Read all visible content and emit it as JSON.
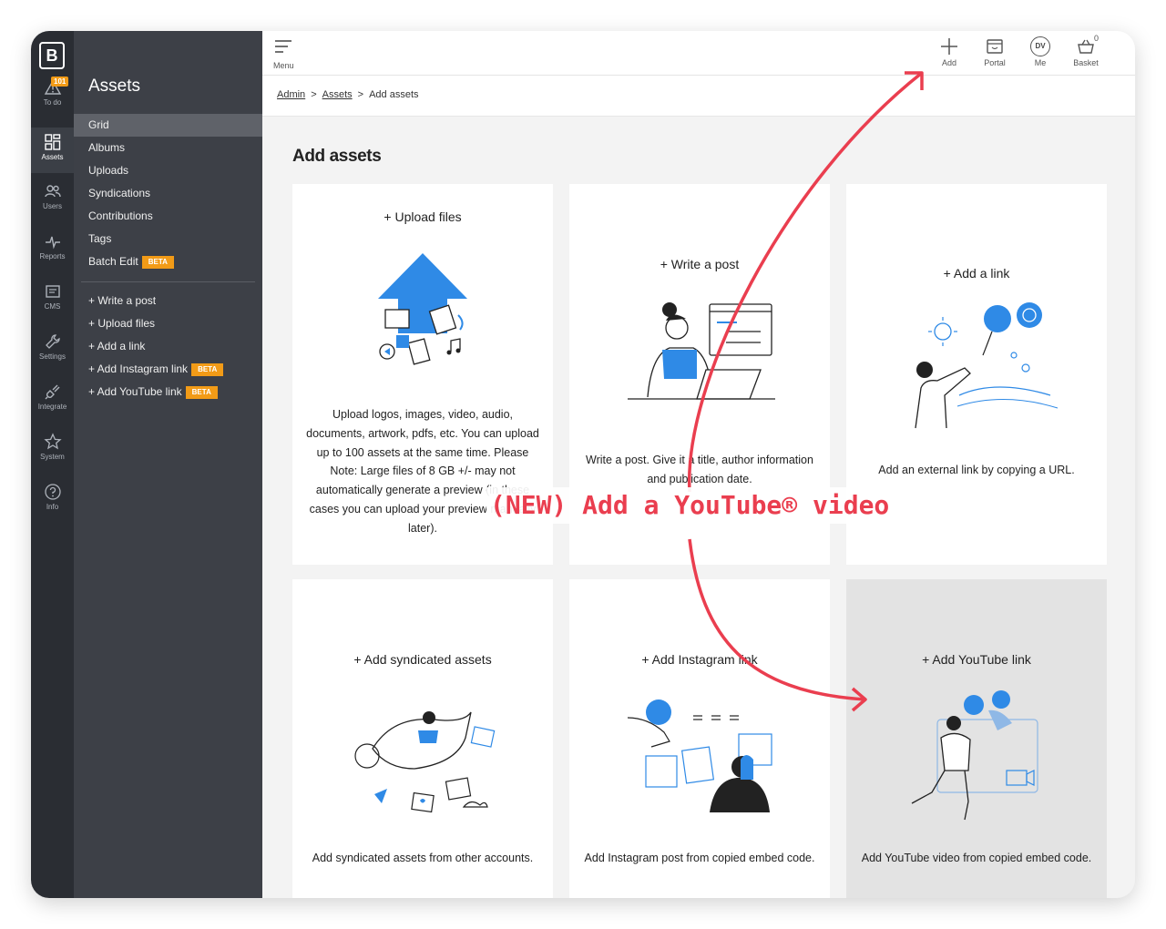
{
  "app": {
    "logo": "B"
  },
  "rail": {
    "items": [
      {
        "label": "To do",
        "icon": "warning-icon",
        "badge": "101"
      },
      {
        "label": "Assets",
        "icon": "grid-icon"
      },
      {
        "label": "Users",
        "icon": "users-icon"
      },
      {
        "label": "Reports",
        "icon": "pulse-icon"
      },
      {
        "label": "CMS",
        "icon": "edit-icon"
      },
      {
        "label": "Settings",
        "icon": "wrench-icon"
      },
      {
        "label": "Integrate",
        "icon": "plug-icon"
      },
      {
        "label": "System",
        "icon": "star-icon"
      },
      {
        "label": "Info",
        "icon": "question-icon"
      }
    ]
  },
  "sidebar": {
    "title": "Assets",
    "items": [
      "Grid",
      "Albums",
      "Uploads",
      "Syndications",
      "Contributions",
      "Tags",
      "Batch Edit"
    ],
    "batch_beta": "BETA",
    "actions": [
      "+ Write a post",
      "+ Upload files",
      "+ Add a link",
      "+ Add Instagram link",
      "+ Add YouTube link"
    ],
    "beta": "BETA"
  },
  "topbar": {
    "menu_label": "Menu",
    "add_label": "Add",
    "portal_label": "Portal",
    "me_label": "Me",
    "me_initials": "DV",
    "basket_label": "Basket",
    "basket_count": "0"
  },
  "breadcrumb": [
    "Admin",
    "Assets",
    "Add assets"
  ],
  "breadcrumb_sep": ">",
  "page": {
    "title": "Add assets"
  },
  "cards": [
    {
      "title": "+ Upload files",
      "desc": "Upload logos, images, video, audio, documents, artwork, pdfs, etc. You can upload up to 100 assets at the same time. Please Note: Large files of 8 GB +/- may not automatically generate a preview (in these cases you can upload your preview manually later)."
    },
    {
      "title": "+ Write a post",
      "desc": "Write a post. Give it a title, author information and publication date."
    },
    {
      "title": "+ Add a link",
      "desc": "Add an external link by copying a URL."
    },
    {
      "title": "+ Add syndicated assets",
      "desc": "Add syndicated assets from other accounts."
    },
    {
      "title": "+ Add Instagram link",
      "desc": "Add Instagram post from copied embed code."
    },
    {
      "title": "+ Add YouTube link",
      "desc": "Add YouTube video from copied embed code."
    }
  ],
  "annotation": {
    "text": "(NEW) Add a YouTube® video",
    "color": "#ea3e4f"
  },
  "colors": {
    "accent": "#f29b17",
    "illustration": "#2f8ae6",
    "rail": "#2a2d33",
    "sidebar": "#3d4047"
  }
}
